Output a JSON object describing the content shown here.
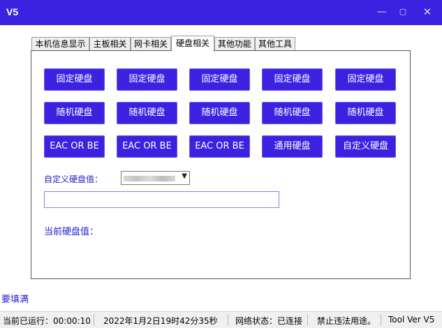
{
  "window": {
    "title": "V5",
    "min_symbol": "—",
    "max_symbol": "▢",
    "close_symbol": "✕"
  },
  "tabs": [
    {
      "label": "本机信息显示",
      "active": false
    },
    {
      "label": "主板相关",
      "active": false
    },
    {
      "label": "网卡相关",
      "active": false
    },
    {
      "label": "硬盘相关",
      "active": true
    },
    {
      "label": "其他功能",
      "active": false
    },
    {
      "label": "其他工具",
      "active": false
    }
  ],
  "buttons": {
    "row1": [
      "固定硬盘",
      "固定硬盘",
      "固定硬盘",
      "固定硬盘",
      "固定硬盘"
    ],
    "row2": [
      "随机硬盘",
      "随机硬盘",
      "随机硬盘",
      "随机硬盘",
      "随机硬盘"
    ],
    "row3": [
      "EAC OR BE",
      "EAC OR BE",
      "EAC OR BE",
      "通用硬盘",
      "自定义硬盘"
    ]
  },
  "custom": {
    "label": "自定义硬盘值：",
    "input_value": ""
  },
  "current": {
    "label": "当前硬盘值："
  },
  "hint": "要填满",
  "status": {
    "runtime": "当前已运行：00:00:10",
    "datetime": "2022年1月2日19时42分35秒",
    "network": "网络状态：已连接",
    "notice": "禁止违法用途。",
    "version": "Tool Ver V5"
  },
  "colors": {
    "accent": "#3a22e0",
    "label_blue": "#1f1fd0"
  }
}
